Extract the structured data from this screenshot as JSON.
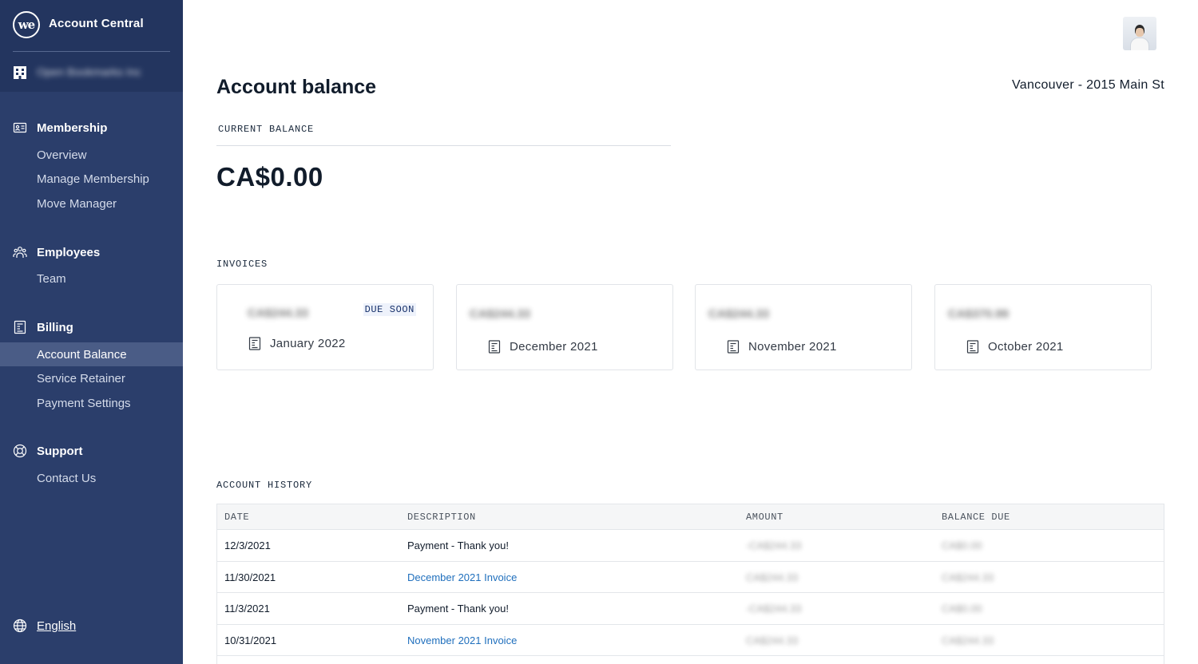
{
  "sidebar": {
    "logo_text": "we",
    "app_title": "Account Central",
    "company_name": "Open Bookmarks Inc",
    "sections": [
      {
        "title": "Membership",
        "icon": "membership-card-icon",
        "items": [
          {
            "label": "Overview"
          },
          {
            "label": "Manage Membership"
          },
          {
            "label": "Move Manager"
          }
        ]
      },
      {
        "title": "Employees",
        "icon": "people-icon",
        "items": [
          {
            "label": "Team"
          }
        ]
      },
      {
        "title": "Billing",
        "icon": "invoice-icon",
        "items": [
          {
            "label": "Account Balance",
            "active": true
          },
          {
            "label": "Service Retainer"
          },
          {
            "label": "Payment Settings"
          }
        ]
      },
      {
        "title": "Support",
        "icon": "lifebuoy-icon",
        "items": [
          {
            "label": "Contact Us"
          }
        ]
      }
    ],
    "language": "English"
  },
  "header": {
    "page_title": "Account balance",
    "location": "Vancouver - 2015 Main St"
  },
  "balance": {
    "label": "CURRENT  BALANCE",
    "amount": "CA$0.00"
  },
  "invoices": {
    "label": "INVOICES",
    "cards": [
      {
        "amount": "CA$244.33",
        "date": "January 2022",
        "badge": "DUE  SOON"
      },
      {
        "amount": "CA$244.33",
        "date": "December 2021"
      },
      {
        "amount": "CA$244.33",
        "date": "November 2021"
      },
      {
        "amount": "CA$370.99",
        "date": "October 2021"
      }
    ]
  },
  "history": {
    "label": "ACCOUNT HISTORY",
    "columns": [
      "DATE",
      "DESCRIPTION",
      "AMOUNT",
      "BALANCE  DUE"
    ],
    "rows": [
      {
        "date": "12/3/2021",
        "description": "Payment - Thank you!",
        "amount": "-CA$244.33",
        "balance_due": "CA$0.00",
        "is_link": false
      },
      {
        "date": "11/30/2021",
        "description": "December 2021 Invoice",
        "amount": "CA$244.33",
        "balance_due": "CA$244.33",
        "is_link": true
      },
      {
        "date": "11/3/2021",
        "description": "Payment - Thank you!",
        "amount": "-CA$244.33",
        "balance_due": "CA$0.00",
        "is_link": false
      },
      {
        "date": "10/31/2021",
        "description": "November 2021 Invoice",
        "amount": "CA$244.33",
        "balance_due": "CA$244.33",
        "is_link": true
      }
    ]
  },
  "colors": {
    "sidebar_bg": "#2b3e6b",
    "sidebar_top_bg": "#23355f",
    "active_item_bg": "#4a5c86",
    "link": "#1f6fbd"
  }
}
